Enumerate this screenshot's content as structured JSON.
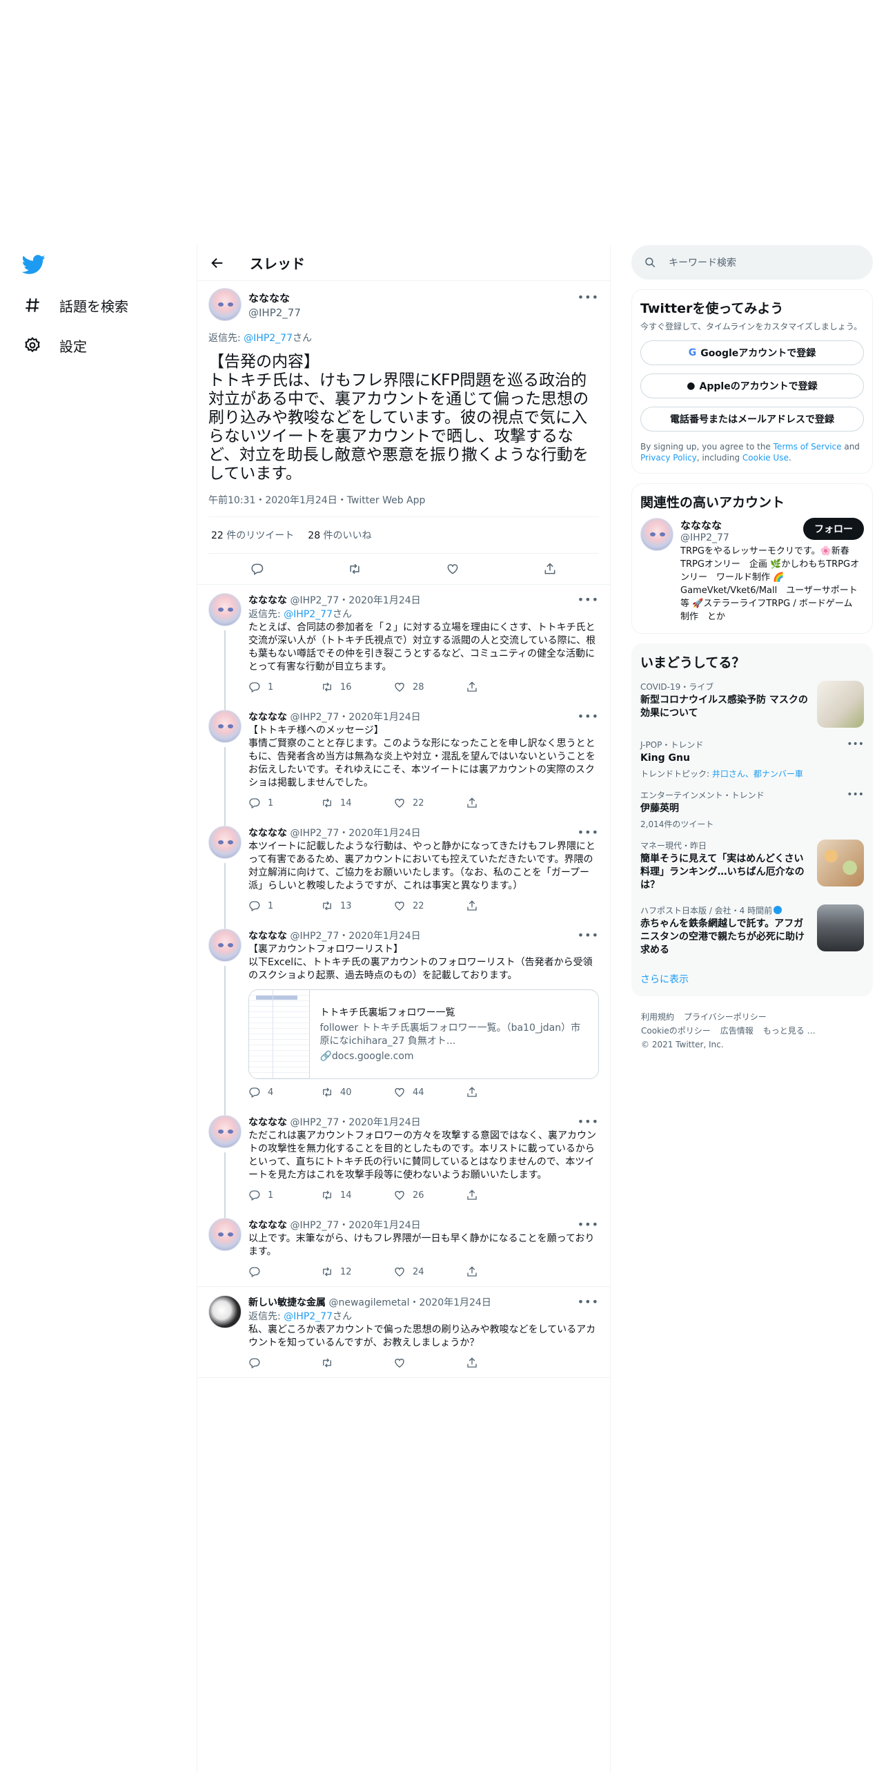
{
  "sidebar": {
    "items": [
      {
        "label": "話題を検索"
      },
      {
        "label": "設定"
      }
    ]
  },
  "header": {
    "title": "スレッド"
  },
  "main_tweet": {
    "name": "なななな",
    "handle": "@IHP2_77",
    "reply_prefix": "返信先: ",
    "reply_handle": "@IHP2_77",
    "reply_suffix": "さん",
    "text": "【告発の内容】\nトトキチ氏は、けもフレ界隈にKFP問題を巡る政治的対立がある中で、裏アカウントを通じて偏った思想の刷り込みや教唆などをしています。彼の視点で気に入らないツイートを裏アカウントで晒し、攻撃するなど、対立を助長し敵意や悪意を振り撒くような行動をしています。",
    "meta": "午前10:31・2020年1月24日・Twitter Web App",
    "retweets_count": "22",
    "retweets_label": " 件のリツイート",
    "likes_count": "28",
    "likes_label": " 件のいいね"
  },
  "replies": [
    {
      "name": "なななな",
      "handle": "@IHP2_77",
      "date": "・2020年1月24日",
      "reply_prefix": "返信先: ",
      "reply_handle": "@IHP2_77",
      "reply_suffix": "さん",
      "text": "たとえば、合同誌の参加者を「２」に対する立場を理由にくさす、トトキチ氏と交流が深い人が（トトキチ氏視点で）対立する派閥の人と交流している際に、根も葉もない噂話でその仲を引き裂こうとするなど、コミュニティの健全な活動にとって有害な行動が目立ちます。",
      "replies": "1",
      "retweets": "16",
      "likes": "28"
    },
    {
      "name": "なななな",
      "handle": "@IHP2_77",
      "date": "・2020年1月24日",
      "text": "【トトキチ様へのメッセージ】\n事情ご賢察のことと存じます。このような形になったことを申し訳なく思うとともに、告発者含め当方は無為な炎上や対立・混乱を望んではいないということをお伝えしたいです。それゆえにこそ、本ツイートには裏アカウントの実際のスクショは掲載しませんでした。",
      "replies": "1",
      "retweets": "14",
      "likes": "22"
    },
    {
      "name": "なななな",
      "handle": "@IHP2_77",
      "date": "・2020年1月24日",
      "text": "本ツイートに記載したような行動は、やっと静かになってきたけもフレ界隈にとって有害であるため、裏アカウントにおいても控えていただきたいです。界隈の対立解消に向けて、ご協力をお願いいたします。（なお、私のことを「ガープー派」らしいと教唆したようですが、これは事実と異なります。）",
      "replies": "1",
      "retweets": "13",
      "likes": "22"
    },
    {
      "name": "なななな",
      "handle": "@IHP2_77",
      "date": "・2020年1月24日",
      "text": "【裏アカウントフォロワーリスト】\n以下Excelに、トトキチ氏の裏アカウントのフォロワーリスト（告発者から受領のスクショより起票、過去時点のもの）を記載しております。",
      "card": {
        "title": "トトキチ氏裏垢フォロワー一覧",
        "desc": "follower トトキチ氏裏垢フォロワー一覧。（ba10_jdan）市原になichihara_27 負無オト...",
        "domain": "docs.google.com"
      },
      "replies": "4",
      "retweets": "40",
      "likes": "44"
    },
    {
      "name": "なななな",
      "handle": "@IHP2_77",
      "date": "・2020年1月24日",
      "text": "ただこれは裏アカウントフォロワーの方々を攻撃する意図ではなく、裏アカウントの攻撃性を無力化することを目的としたものです。本リストに載っているからといって、直ちにトトキチ氏の行いに賛同しているとはなりませんので、本ツイートを見た方はこれを攻撃手段等に使わないようお願いいたします。",
      "replies": "1",
      "retweets": "14",
      "likes": "26"
    },
    {
      "name": "なななな",
      "handle": "@IHP2_77",
      "date": "・2020年1月24日",
      "text": "以上です。末筆ながら、けもフレ界隈が一日も早く静かになることを願っております。",
      "replies": "",
      "retweets": "12",
      "likes": "24"
    },
    {
      "name": "新しい敏捷な金属",
      "handle": "@newagilemetal",
      "date": "・2020年1月24日",
      "reply_prefix": "返信先: ",
      "reply_handle": "@IHP2_77",
      "reply_suffix": "さん",
      "text": "私、裏どころか表アカウントで偏った思想の刷り込みや教唆などをしているアカウントを知っているんですが、お教えしましょうか？",
      "replies": "",
      "retweets": "",
      "likes": ""
    }
  ],
  "search": {
    "placeholder": "キーワード検索"
  },
  "signup": {
    "title": "Twitterを使ってみよう",
    "sub": "今すぐ登録して、タイムラインをカスタマイズしましょう。",
    "google": "Googleアカウントで登録",
    "apple": "Appleのアカウントで登録",
    "phone": "電話番号またはメールアドレスで登録",
    "terms_1": "By signing up, you agree to the ",
    "terms_link1": "Terms of Service",
    "terms_2": " and ",
    "terms_link2": "Privacy Policy",
    "terms_3": ", including ",
    "terms_link3": "Cookie Use",
    "terms_4": "."
  },
  "related": {
    "title": "関連性の高いアカウント",
    "name": "なななな",
    "handle": "@IHP2_77",
    "follow": "フォロー",
    "bio": "TRPGをやるレッサーモクリです。🌸新春TRPGオンリー　企画 🌿かしわもちTRPGオンリー　ワールド制作 🌈GameVket/Vket6/Mall　ユーザーサポート等 🚀ステラーライフTRPG / ボードゲーム　制作　とか"
  },
  "trends": {
    "title": "いまどうしてる？",
    "items": [
      {
        "cat": "COVID-19・ライブ",
        "title": "新型コロナウイルス感染予防 マスクの効果について"
      },
      {
        "cat": "J-POP・トレンド",
        "title": "King Gnu",
        "topic_prefix": "トレンドトピック: ",
        "topic": "井口さん、都ナンバー車"
      },
      {
        "cat": "エンターテインメント・トレンド",
        "title": "伊藤英明",
        "count": "2,014件のツイート"
      },
      {
        "cat": "マネー現代・昨日",
        "title": "簡単そうに見えて「実はめんどくさい料理」ランキング…いちばん厄介なのは？"
      },
      {
        "cat": "ハフポスト日本版 / 会社・4 時間前",
        "title": "赤ちゃんを鉄条網越しで託す。アフガニスタンの空港で親たちが必死に助け求める"
      }
    ],
    "show_more": "さらに表示"
  },
  "footer": {
    "links": [
      "利用規約",
      "プライバシーポリシー",
      "Cookieのポリシー",
      "広告情報",
      "もっと見る …"
    ],
    "copyright": "© 2021 Twitter, Inc."
  },
  "colors": {
    "accent": "#1d9bf0",
    "text": "#0f1419",
    "muted": "#536471"
  }
}
